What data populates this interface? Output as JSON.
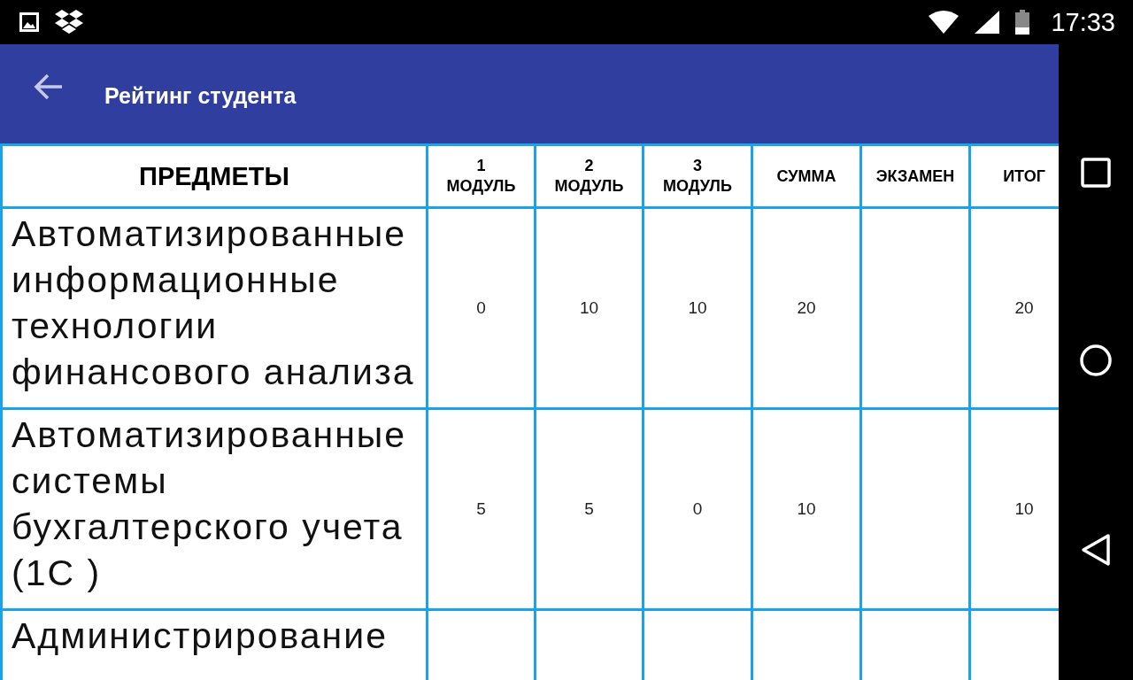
{
  "status_bar": {
    "time": "17:33"
  },
  "app_bar": {
    "title": "Рейтинг студента"
  },
  "table": {
    "columns": [
      {
        "label": "ПРЕДМЕТЫ"
      },
      {
        "label": "1\nМОДУЛЬ"
      },
      {
        "label": "2\nМОДУЛЬ"
      },
      {
        "label": "3\nМОДУЛЬ"
      },
      {
        "label": "СУММА"
      },
      {
        "label": "ЭКЗАМЕН"
      },
      {
        "label": "ИТОГ"
      }
    ],
    "rows": [
      {
        "subject": "Автоматизированные информационные технологии финансового анализа",
        "module_1": "0",
        "module_2": "10",
        "module_3": "10",
        "sum": "20",
        "total": "20"
      },
      {
        "subject": "Автоматизированные системы бухгалтерского учета (1С )",
        "module_1": "5",
        "module_2": "5",
        "module_3": "0",
        "sum": "10",
        "total": "10"
      },
      {
        "subject": "Администрирование"
      }
    ]
  }
}
